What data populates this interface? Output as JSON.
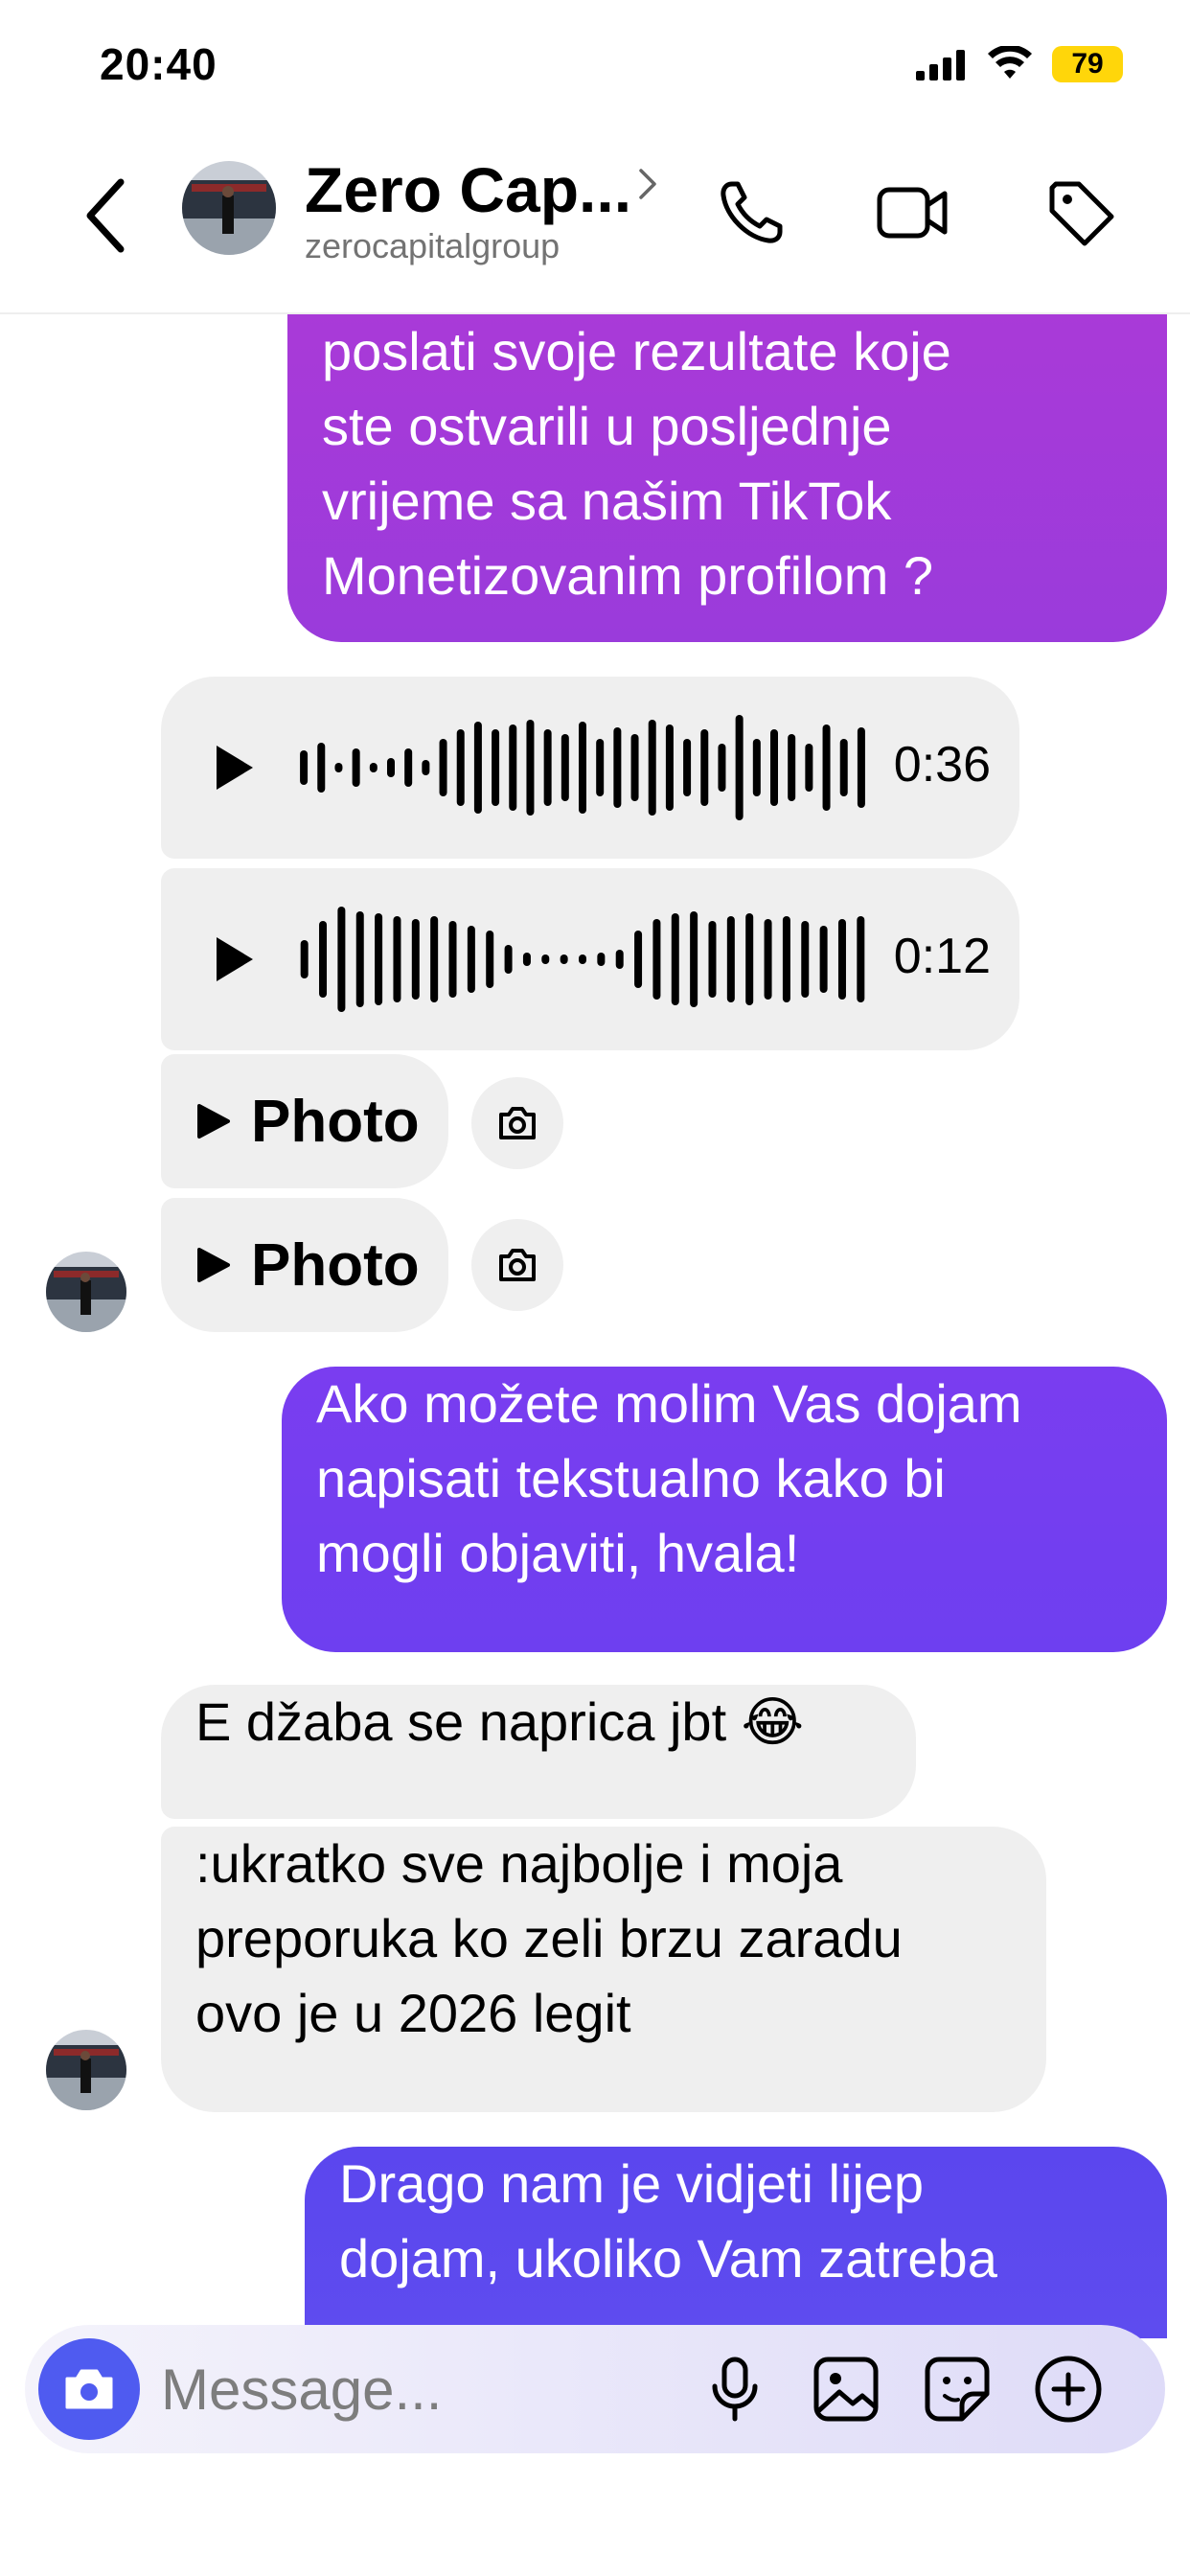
{
  "status": {
    "time": "20:40",
    "battery": "79"
  },
  "header": {
    "name": "Zero Cap...",
    "username": "zerocapitalgroup"
  },
  "messages": {
    "out1": [
      "poslati svoje rezultate koje",
      "ste ostvarili u posljednje",
      "vrijeme sa našim TikTok",
      "Monetizovanim profilom ?"
    ],
    "voice1_duration": "0:36",
    "voice2_duration": "0:12",
    "photo1_label": "Photo",
    "photo2_label": "Photo",
    "out2": [
      "Ako možete molim Vas dojam",
      "napisati tekstualno kako bi",
      "mogli objaviti, hvala!"
    ],
    "in1": "E džaba se naprica jbt 😂",
    "in2": [
      ":ukratko sve najbolje i moja",
      "preporuka ko zeli brzu zaradu",
      "ovo je u 2026 legit"
    ],
    "out3": [
      "Drago nam je vidjeti lijep",
      "dojam, ukoliko Vam zatreba"
    ]
  },
  "composer": {
    "placeholder": "Message..."
  },
  "icons": {
    "back": "chevron-left-icon",
    "phone": "phone-icon",
    "video": "video-camera-icon",
    "tag": "tag-icon",
    "camera": "camera-icon",
    "mic": "microphone-icon",
    "gallery": "image-icon",
    "sticker": "sticker-icon",
    "plus": "plus-circle-icon"
  },
  "colors": {
    "accent": "#4f5bf0",
    "bubble_in": "#efefef",
    "out_purple": "#a93ad8",
    "out_violet": "#7a3df0",
    "out_indigo": "#5b46ee"
  }
}
